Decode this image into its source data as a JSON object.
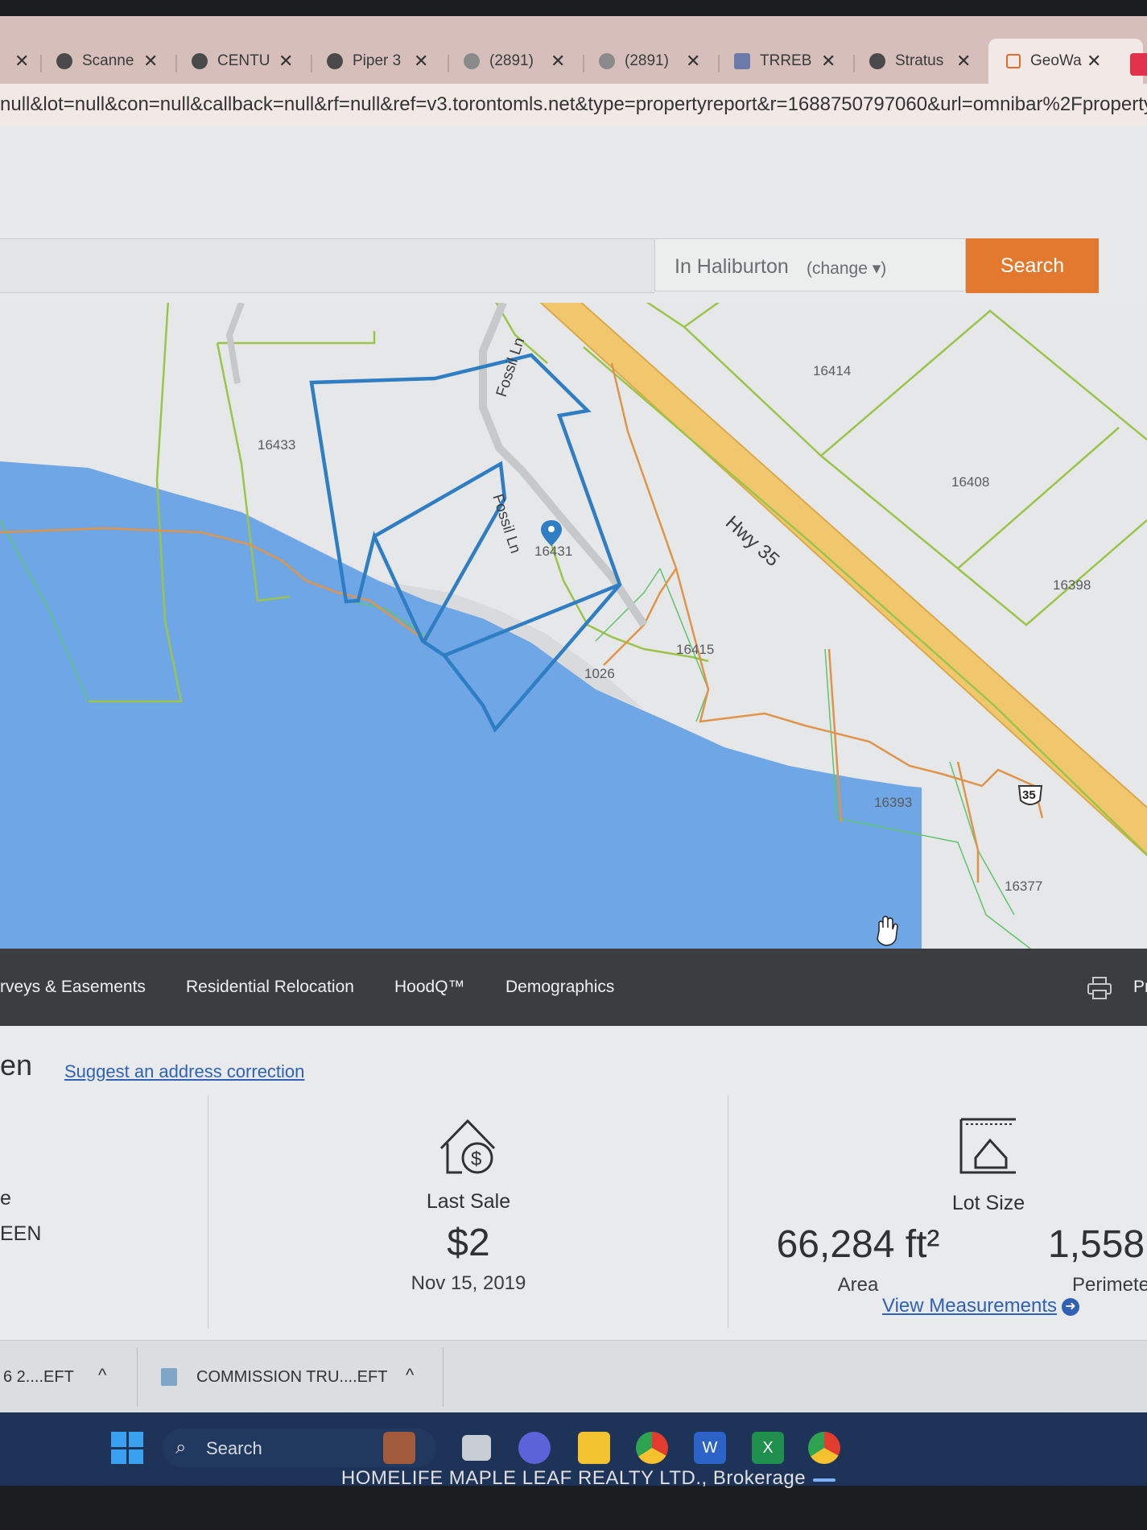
{
  "tabs": [
    {
      "label": "",
      "icon": "close-icon"
    },
    {
      "label": "Scanne",
      "icon": "globe-icon"
    },
    {
      "label": "CENTU",
      "icon": "century21-icon"
    },
    {
      "label": "Piper 3",
      "icon": "century21-icon"
    },
    {
      "label": "(2891)",
      "icon": "chat-icon"
    },
    {
      "label": "(2891)",
      "icon": "chat-icon"
    },
    {
      "label": "TRREB",
      "icon": "trreb-icon"
    },
    {
      "label": "Stratus",
      "icon": "globe-icon"
    },
    {
      "label": "GeoWa",
      "icon": "geowarehouse-icon"
    }
  ],
  "address_bar": {
    "url": "null&lot=null&con=null&callback=null&rf=null&ref=v3.torontomls.net&type=propertyreport&r=1688750797060&url=omnibar%2Fproperty"
  },
  "search": {
    "location_text": "In Haliburton",
    "change_label": "(change ▾)",
    "button_label": "Search"
  },
  "map": {
    "parcel_labels": [
      "16433",
      "16414",
      "16408",
      "16398",
      "16431",
      "16415",
      "1026",
      "16393",
      "16377"
    ],
    "road_labels": [
      "Fossil Ln",
      "Fossil Ln",
      "Hwy 35"
    ],
    "highway_shield": "35",
    "colors": {
      "water": "#6fa7e6",
      "land": "#e6e7e8",
      "highway": "#f1c76e",
      "selected_parcel": "#2f7dc2",
      "lot_lines": "#9cc34a",
      "hydro_line": "#e0944a"
    }
  },
  "nav": {
    "items": [
      "rveys & Easements",
      "Residential Relocation",
      "HoodQ™",
      "Demographics"
    ],
    "print_label": "Pr"
  },
  "details": {
    "heading_fragment": "en",
    "suggest_link": "Suggest an address correction",
    "left_label_fragment": "e",
    "left_value_fragment": "EEN",
    "last_sale": {
      "label": "Last Sale",
      "price": "$2",
      "date": "Nov 15, 2019"
    },
    "lot_size": {
      "label": "Lot Size",
      "area_value": "66,284 ft²",
      "area_label": "Area",
      "perimeter_value": "1,558",
      "perimeter_label": "Perimete"
    },
    "view_measurements": "View Measurements"
  },
  "downloads": [
    {
      "label": "6 2....EFT"
    },
    {
      "label": "COMMISSION TRU....EFT"
    }
  ],
  "taskbar": {
    "search_label": "Search",
    "apps": [
      "windows-start-icon",
      "search-icon",
      "game-icon",
      "task-view-icon",
      "teams-icon",
      "file-explorer-icon",
      "chrome-icon",
      "word-icon",
      "excel-icon",
      "chrome-profile-icon"
    ]
  },
  "footer_brand": "HOMELIFE MAPLE LEAF REALTY LTD., Brokerage"
}
